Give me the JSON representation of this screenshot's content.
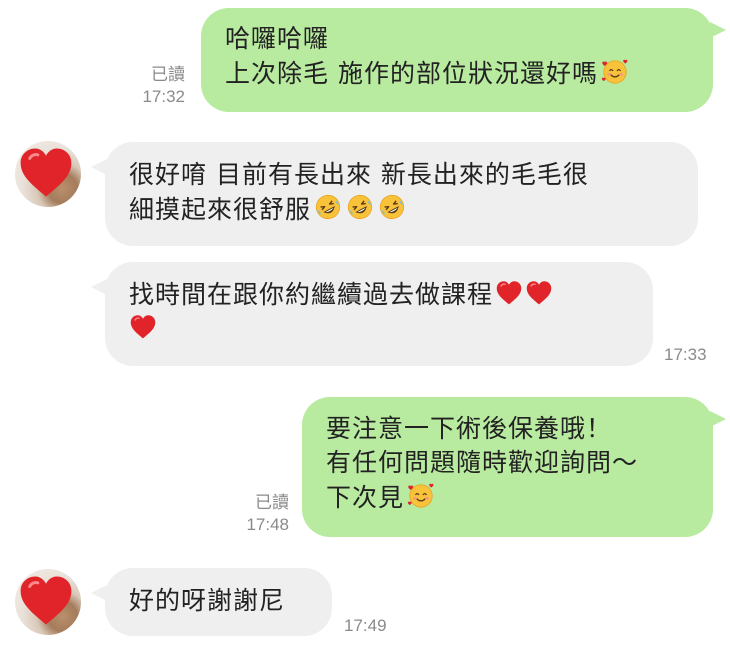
{
  "messages": [
    {
      "id": "m1",
      "direction": "outgoing",
      "lines": [
        "哈囉哈囉",
        "上次除毛 施作的部位狀況還好嗎"
      ],
      "emoji_after_last_line": [
        "smiling-face-with-hearts-icon"
      ],
      "read_label": "已讀",
      "time": "17:32"
    },
    {
      "id": "m2",
      "direction": "incoming",
      "lines": [
        "很好唷 目前有長出來 新長出來的毛毛很",
        "細摸起來很舒服"
      ],
      "emoji_after_last_line": [
        "rolling-on-floor-laughing-icon",
        "rolling-on-floor-laughing-icon",
        "rolling-on-floor-laughing-icon"
      ]
    },
    {
      "id": "m3",
      "direction": "incoming",
      "lines": [
        "找時間在跟你約繼續過去做課程"
      ],
      "emoji_after_first_line": [
        "red-heart-icon",
        "red-heart-icon"
      ],
      "emoji_line": [
        "red-heart-icon"
      ],
      "time": "17:33"
    },
    {
      "id": "m4",
      "direction": "outgoing",
      "lines": [
        "要注意一下術後保養哦！",
        "有任何問題隨時歡迎詢問～",
        "下次見"
      ],
      "emoji_after_last_line": [
        "smiling-face-with-hearts-icon"
      ],
      "read_label": "已讀",
      "time": "17:48"
    },
    {
      "id": "m5",
      "direction": "incoming",
      "lines": [
        "好的呀謝謝尼"
      ],
      "time": "17:49"
    }
  ],
  "contact": {
    "avatar_icon": "red-heart-icon"
  },
  "colors": {
    "outgoing_bubble": "#b8eaa0",
    "incoming_bubble": "#efefef",
    "text": "#222222",
    "meta_text": "#8a8a8a",
    "heart_red": "#e0242a"
  }
}
